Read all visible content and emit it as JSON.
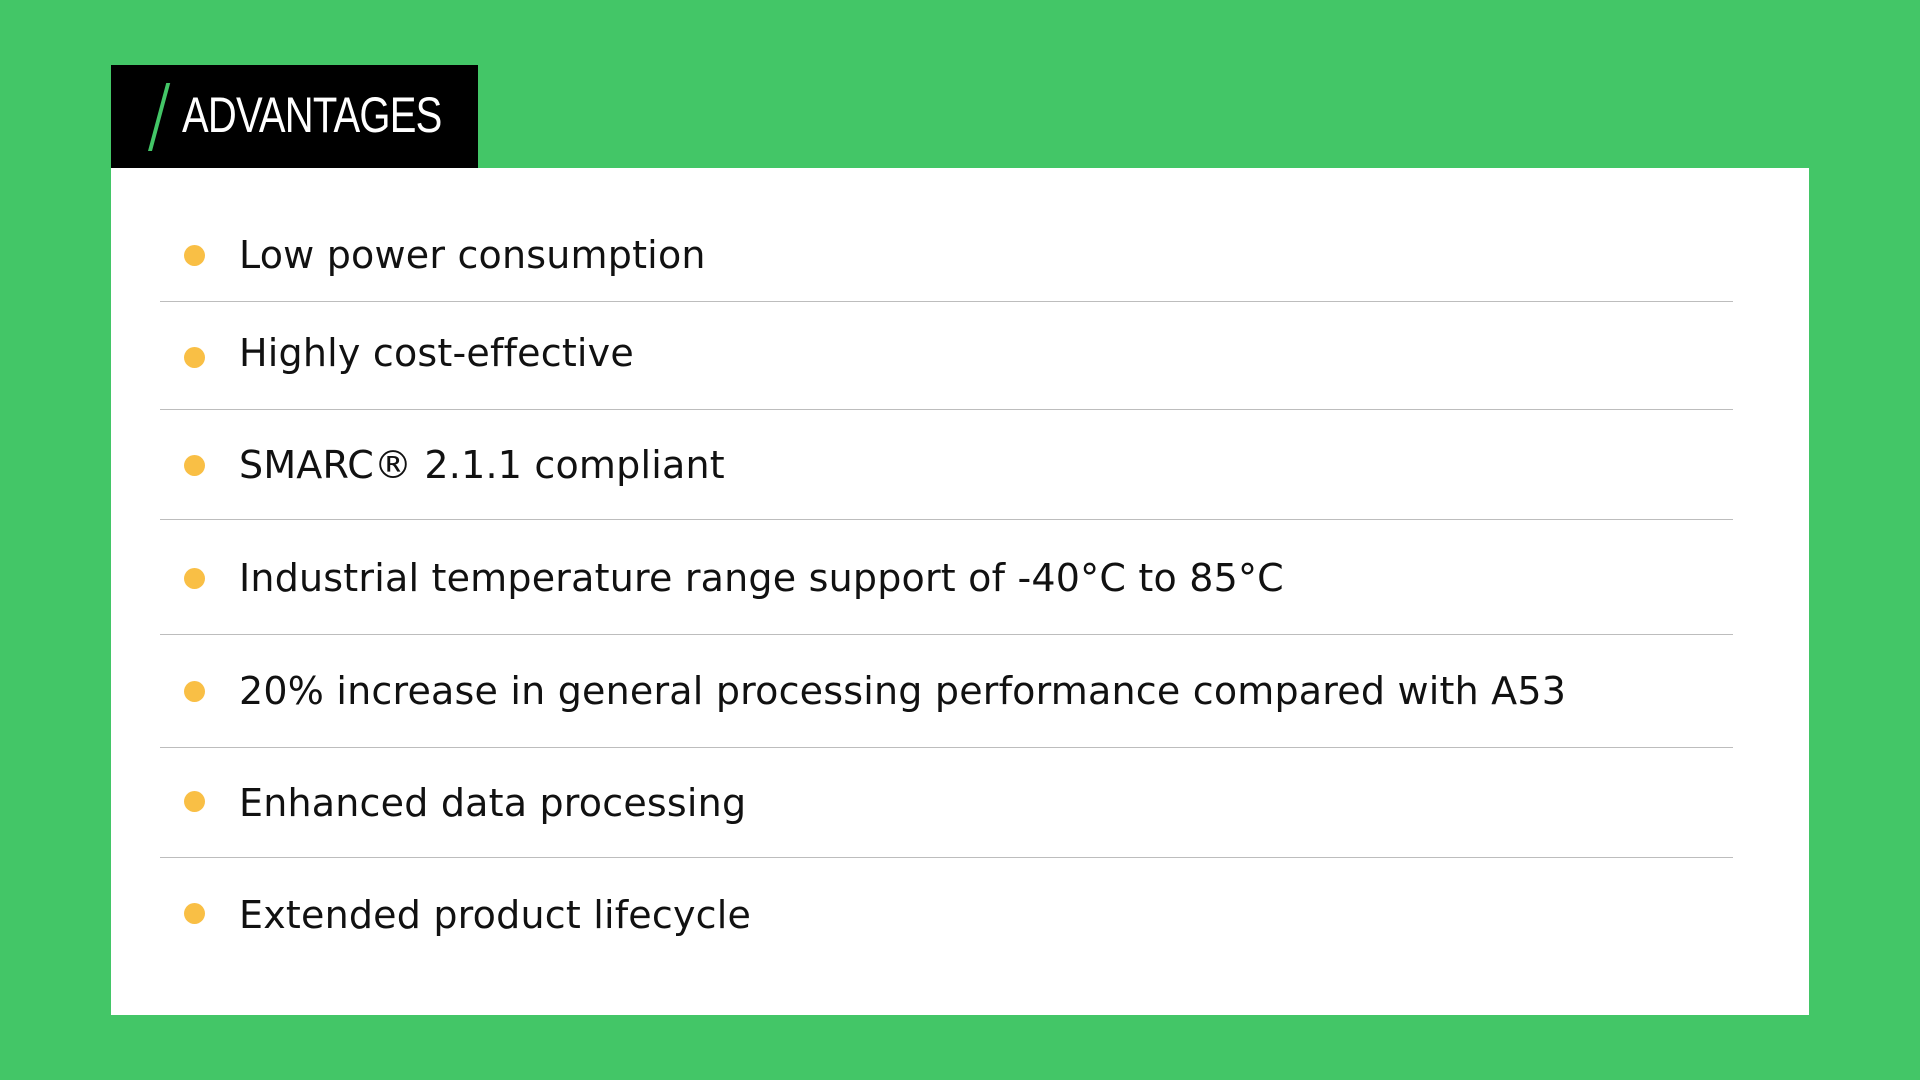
{
  "header": {
    "title": "ADVANTAGES"
  },
  "advantages": [
    {
      "label": "Low power consumption"
    },
    {
      "label": "Highly cost-effective"
    },
    {
      "label": "SMARC® 2.1.1 compliant"
    },
    {
      "label": "Industrial temperature range support of -40°C to 85°C"
    },
    {
      "label": "20% increase in general processing performance compared with A53"
    },
    {
      "label": "Enhanced data processing"
    },
    {
      "label": "Extended product lifecycle"
    }
  ],
  "colors": {
    "background": "#43C667",
    "header_tab": "#000000",
    "panel": "#FFFFFF",
    "bullet": "#F9BF45",
    "divider": "#BDBDBD",
    "slash": "#43C667"
  }
}
